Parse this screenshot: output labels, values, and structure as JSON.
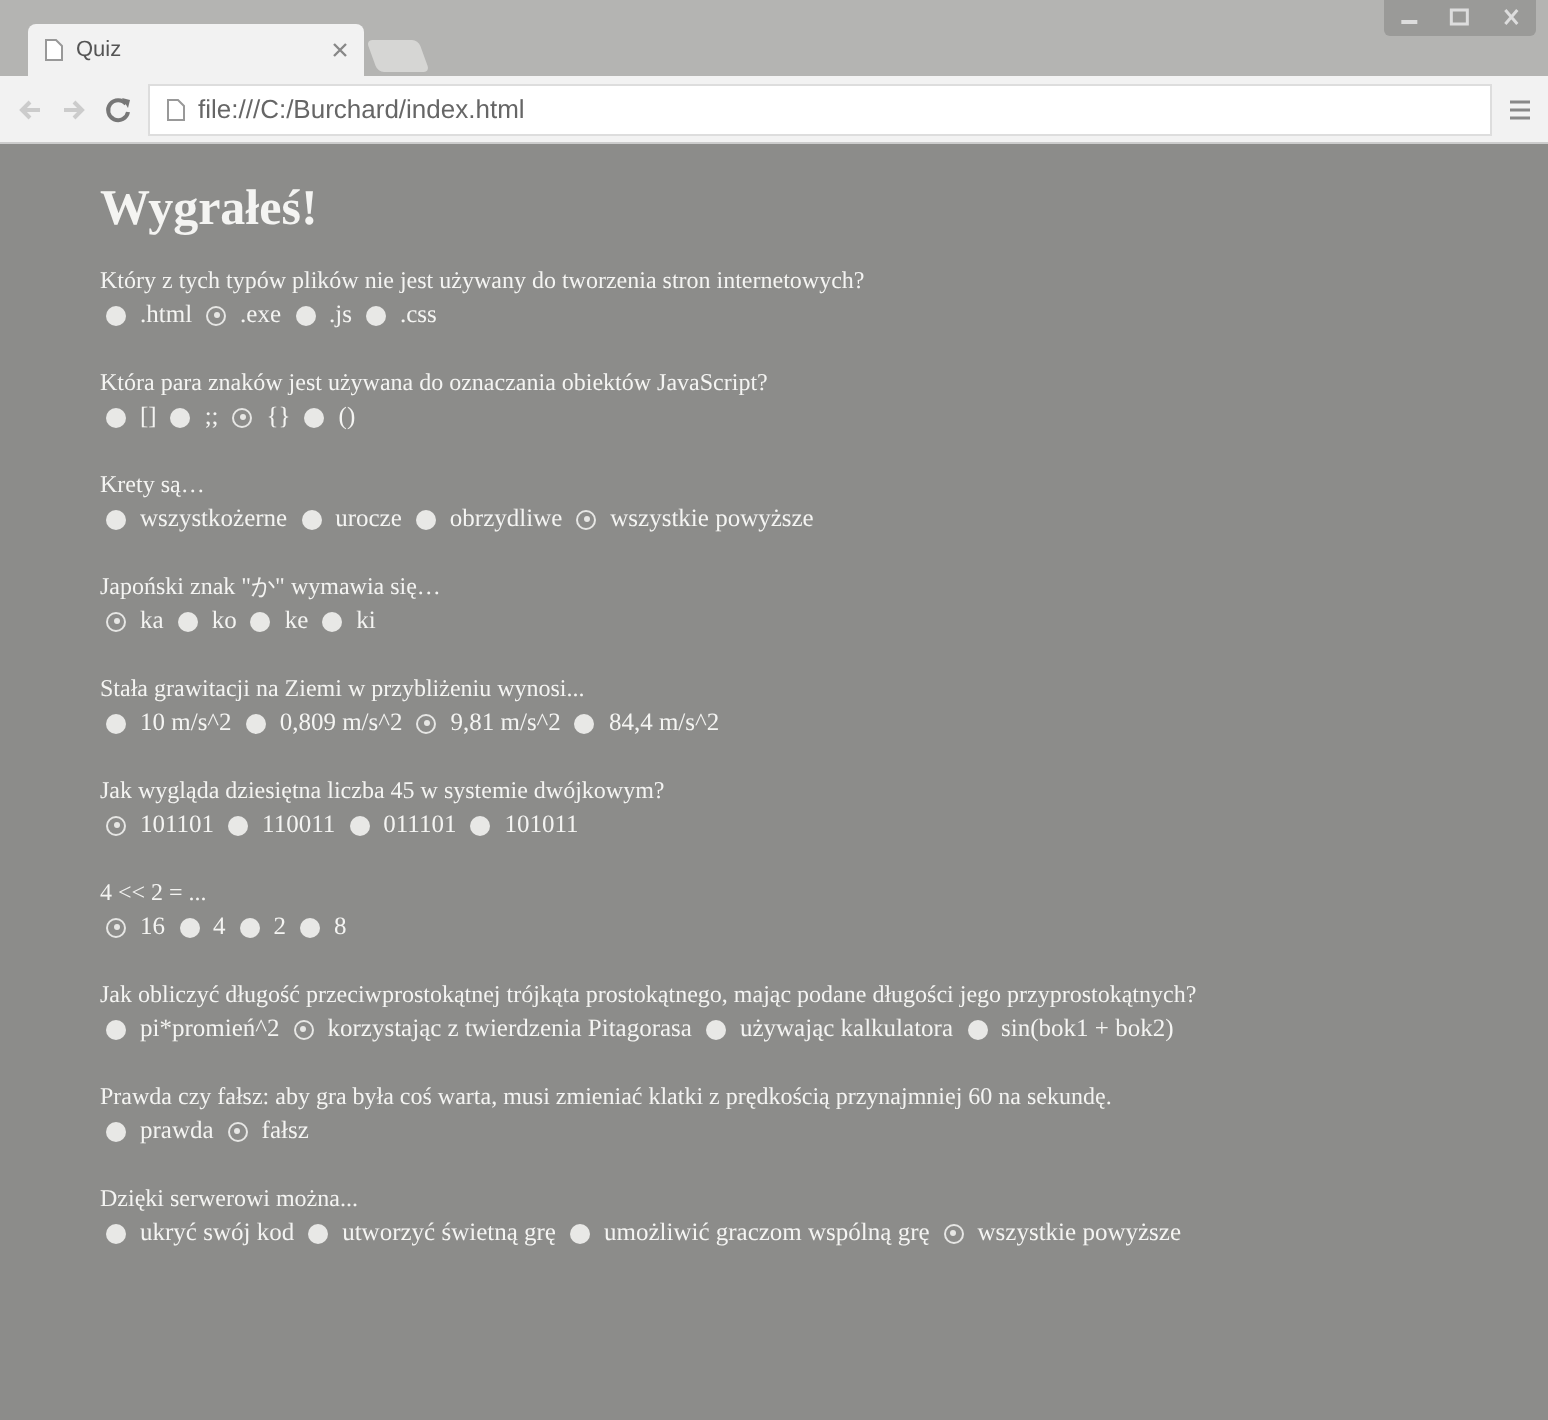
{
  "browser": {
    "tab_title": "Quiz",
    "address": "file:///C:/Burchard/index.html"
  },
  "heading": "Wygrałeś!",
  "questions": [
    {
      "text": "Który z tych typów plików nie jest używany do tworzenia stron internetowych?",
      "options": [
        {
          "label": ".html",
          "selected": false
        },
        {
          "label": ".exe",
          "selected": true
        },
        {
          "label": ".js",
          "selected": false
        },
        {
          "label": ".css",
          "selected": false
        }
      ]
    },
    {
      "text": "Która para znaków jest używana do oznaczania obiektów JavaScript?",
      "options": [
        {
          "label": "[]",
          "selected": false
        },
        {
          "label": ";;",
          "selected": false
        },
        {
          "label": "{}",
          "selected": true
        },
        {
          "label": "()",
          "selected": false
        }
      ]
    },
    {
      "text": "Krety są…",
      "options": [
        {
          "label": "wszystkożerne",
          "selected": false
        },
        {
          "label": "urocze",
          "selected": false
        },
        {
          "label": "obrzydliwe",
          "selected": false
        },
        {
          "label": "wszystkie powyższe",
          "selected": true
        }
      ]
    },
    {
      "text": "Japoński znak \"か\" wymawia się…",
      "options": [
        {
          "label": "ka",
          "selected": true
        },
        {
          "label": "ko",
          "selected": false
        },
        {
          "label": "ke",
          "selected": false
        },
        {
          "label": "ki",
          "selected": false
        }
      ]
    },
    {
      "text": "Stała grawitacji na Ziemi w przybliżeniu wynosi...",
      "options": [
        {
          "label": "10 m/s^2",
          "selected": false
        },
        {
          "label": "0,809 m/s^2",
          "selected": false
        },
        {
          "label": "9,81 m/s^2",
          "selected": true
        },
        {
          "label": "84,4 m/s^2",
          "selected": false
        }
      ]
    },
    {
      "text": "Jak wygląda dziesiętna liczba 45 w systemie dwójkowym?",
      "options": [
        {
          "label": "101101",
          "selected": true
        },
        {
          "label": "110011",
          "selected": false
        },
        {
          "label": "011101",
          "selected": false
        },
        {
          "label": "101011",
          "selected": false
        }
      ]
    },
    {
      "text": "4 << 2 = ...",
      "options": [
        {
          "label": "16",
          "selected": true
        },
        {
          "label": "4",
          "selected": false
        },
        {
          "label": "2",
          "selected": false
        },
        {
          "label": "8",
          "selected": false
        }
      ]
    },
    {
      "text": "Jak obliczyć długość przeciwprostokątnej trójkąta prostokątnego, mając podane długości jego przyprostokątnych?",
      "options": [
        {
          "label": "pi*promień^2",
          "selected": false
        },
        {
          "label": "korzystając z twierdzenia Pitagorasa",
          "selected": true
        },
        {
          "label": "używając kalkulatora",
          "selected": false
        },
        {
          "label": "sin(bok1 + bok2)",
          "selected": false
        }
      ]
    },
    {
      "text": "Prawda czy fałsz: aby gra była coś warta, musi zmieniać klatki z prędkością przynajmniej 60 na sekundę.",
      "options": [
        {
          "label": "prawda",
          "selected": false
        },
        {
          "label": "fałsz",
          "selected": true
        }
      ]
    },
    {
      "text": "Dzięki serwerowi można...",
      "options": [
        {
          "label": "ukryć swój kod",
          "selected": false
        },
        {
          "label": "utworzyć świetną grę",
          "selected": false
        },
        {
          "label": "umożliwić graczom wspólną grę",
          "selected": false
        },
        {
          "label": "wszystkie powyższe",
          "selected": true
        }
      ]
    }
  ]
}
